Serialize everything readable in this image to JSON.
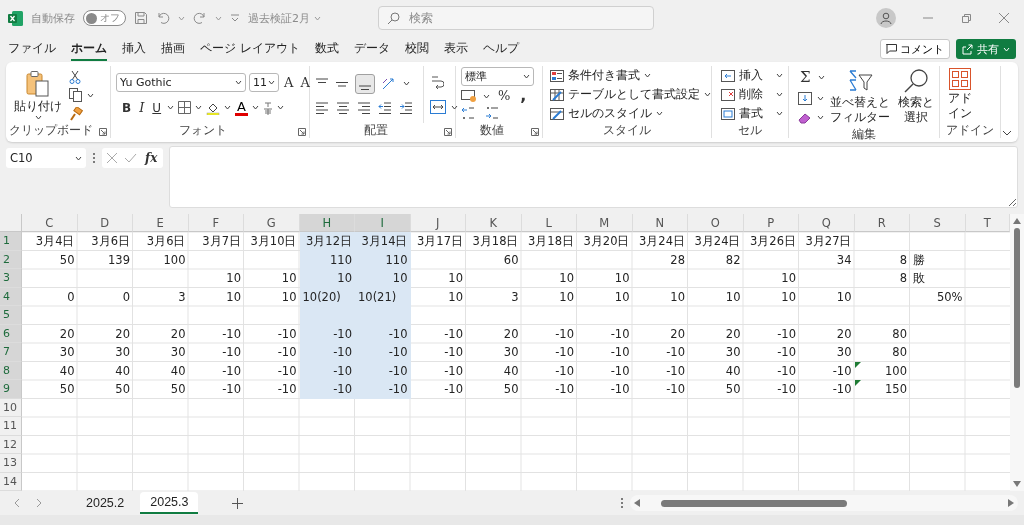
{
  "title_bar": {
    "autosave_label": "自動保存",
    "autosave_toggle": {
      "label": "オフ",
      "on": false
    },
    "document_title": "過去検証2月",
    "search": {
      "placeholder": "検索"
    }
  },
  "menu_tabs": [
    {
      "label": "ファイル",
      "selected": false
    },
    {
      "label": "ホーム",
      "selected": true
    },
    {
      "label": "挿入",
      "selected": false
    },
    {
      "label": "描画",
      "selected": false
    },
    {
      "label": "ページ レイアウト",
      "selected": false
    },
    {
      "label": "数式",
      "selected": false
    },
    {
      "label": "データ",
      "selected": false
    },
    {
      "label": "校閲",
      "selected": false
    },
    {
      "label": "表示",
      "selected": false
    },
    {
      "label": "ヘルプ",
      "selected": false
    }
  ],
  "menu_actions": {
    "comment": "コメント",
    "share": "共有"
  },
  "ribbon": {
    "groups": [
      {
        "kind": "clipboard",
        "label": "クリップボード",
        "paste": "貼り付け"
      },
      {
        "kind": "font",
        "label": "フォント",
        "font_name": "Yu Gothic",
        "font_size": "11",
        "grow_font": "A",
        "shrink_font": "A",
        "bold": "B",
        "italic": "I",
        "underline": "U",
        "font_color": "A"
      },
      {
        "kind": "alignment",
        "label": "配置"
      },
      {
        "kind": "number",
        "label": "数値",
        "format": "標準",
        "percent": "%",
        "comma": ","
      },
      {
        "kind": "styles",
        "label": "スタイル",
        "commands": [
          "条件付き書式",
          "テーブルとして書式設定",
          "セルのスタイル"
        ]
      },
      {
        "kind": "cells",
        "label": "セル",
        "commands": [
          "挿入",
          "削除",
          "書式"
        ]
      },
      {
        "kind": "editing",
        "label": "編集",
        "sum": "Σ",
        "sort_filter": [
          "並べ替えと",
          "フィルター"
        ],
        "find_select": [
          "検索と",
          "選択"
        ]
      },
      {
        "kind": "addins",
        "label": "アドイン",
        "button": [
          "アド",
          "イン"
        ]
      }
    ]
  },
  "formula_bar": {
    "name_box": "C10",
    "function_label": "fx"
  },
  "grid": {
    "columns": [
      {
        "label": "C",
        "selected": false
      },
      {
        "label": "D",
        "selected": false
      },
      {
        "label": "E",
        "selected": false
      },
      {
        "label": "F",
        "selected": false
      },
      {
        "label": "G",
        "selected": false
      },
      {
        "label": "H",
        "selected": true
      },
      {
        "label": "I",
        "selected": true
      },
      {
        "label": "J",
        "selected": false
      },
      {
        "label": "K",
        "selected": false
      },
      {
        "label": "L",
        "selected": false
      },
      {
        "label": "M",
        "selected": false
      },
      {
        "label": "N",
        "selected": false
      },
      {
        "label": "O",
        "selected": false
      },
      {
        "label": "P",
        "selected": false
      },
      {
        "label": "Q",
        "selected": false
      },
      {
        "label": "R",
        "selected": false
      },
      {
        "label": "S",
        "selected": false
      },
      {
        "label": "T",
        "selected": false
      }
    ],
    "rows": [
      {
        "number": "1",
        "selected": true,
        "cells": [
          {
            "text": "3月4日",
            "kind": "number"
          },
          {
            "text": "3月6日",
            "kind": "number"
          },
          {
            "text": "3月6日",
            "kind": "number"
          },
          {
            "text": "3月7日",
            "kind": "number"
          },
          {
            "text": "3月10日",
            "kind": "number"
          },
          {
            "text": "3月12日",
            "kind": "number"
          },
          {
            "text": "3月14日",
            "kind": "number"
          },
          {
            "text": "3月17日",
            "kind": "number"
          },
          {
            "text": "3月18日",
            "kind": "number"
          },
          {
            "text": "3月18日",
            "kind": "number"
          },
          {
            "text": "3月20日",
            "kind": "number"
          },
          {
            "text": "3月24日",
            "kind": "number"
          },
          {
            "text": "3月24日",
            "kind": "number"
          },
          {
            "text": "3月26日",
            "kind": "number"
          },
          {
            "text": "3月27日",
            "kind": "number"
          },
          null,
          null,
          null
        ]
      },
      {
        "number": "2",
        "selected": true,
        "cells": [
          {
            "text": "50",
            "kind": "number"
          },
          {
            "text": "139",
            "kind": "number"
          },
          {
            "text": "100",
            "kind": "number"
          },
          null,
          null,
          {
            "text": "110",
            "kind": "number"
          },
          {
            "text": "110",
            "kind": "number"
          },
          null,
          {
            "text": "60",
            "kind": "number"
          },
          null,
          null,
          {
            "text": "28",
            "kind": "number"
          },
          {
            "text": "82",
            "kind": "number"
          },
          null,
          {
            "text": "34",
            "kind": "number"
          },
          {
            "text": "8",
            "kind": "number"
          },
          {
            "text": "勝",
            "kind": "text"
          },
          null
        ]
      },
      {
        "number": "3",
        "selected": true,
        "cells": [
          null,
          null,
          null,
          {
            "text": "10",
            "kind": "number"
          },
          {
            "text": "10",
            "kind": "number"
          },
          {
            "text": "10",
            "kind": "number"
          },
          {
            "text": "10",
            "kind": "number"
          },
          {
            "text": "10",
            "kind": "number"
          },
          null,
          {
            "text": "10",
            "kind": "number"
          },
          {
            "text": "10",
            "kind": "number"
          },
          null,
          null,
          {
            "text": "10",
            "kind": "number"
          },
          null,
          {
            "text": "8",
            "kind": "number"
          },
          {
            "text": "敗",
            "kind": "text"
          },
          null
        ]
      },
      {
        "number": "4",
        "selected": true,
        "cells": [
          {
            "text": "0",
            "kind": "number"
          },
          {
            "text": "0",
            "kind": "number"
          },
          {
            "text": "3",
            "kind": "number"
          },
          {
            "text": "10",
            "kind": "number"
          },
          {
            "text": "10",
            "kind": "number"
          },
          {
            "text": "10(20)",
            "kind": "text"
          },
          {
            "text": "10(21)",
            "kind": "text"
          },
          {
            "text": "10",
            "kind": "number"
          },
          {
            "text": "3",
            "kind": "number"
          },
          {
            "text": "10",
            "kind": "number"
          },
          {
            "text": "10",
            "kind": "number"
          },
          {
            "text": "10",
            "kind": "number"
          },
          {
            "text": "10",
            "kind": "number"
          },
          {
            "text": "10",
            "kind": "number"
          },
          {
            "text": "10",
            "kind": "number"
          },
          null,
          {
            "text": "50%",
            "kind": "number"
          },
          null
        ]
      },
      {
        "number": "5",
        "selected": true
      },
      {
        "number": "6",
        "selected": true,
        "cells": [
          {
            "text": "20",
            "kind": "number"
          },
          {
            "text": "20",
            "kind": "number"
          },
          {
            "text": "20",
            "kind": "number"
          },
          {
            "text": "-10",
            "kind": "number"
          },
          {
            "text": "-10",
            "kind": "number"
          },
          {
            "text": "-10",
            "kind": "number"
          },
          {
            "text": "-10",
            "kind": "number"
          },
          {
            "text": "-10",
            "kind": "number"
          },
          {
            "text": "20",
            "kind": "number"
          },
          {
            "text": "-10",
            "kind": "number"
          },
          {
            "text": "-10",
            "kind": "number"
          },
          {
            "text": "20",
            "kind": "number"
          },
          {
            "text": "20",
            "kind": "number"
          },
          {
            "text": "-10",
            "kind": "number"
          },
          {
            "text": "20",
            "kind": "number"
          },
          {
            "text": "80",
            "kind": "number"
          },
          null,
          null
        ]
      },
      {
        "number": "7",
        "selected": true,
        "cells": [
          {
            "text": "30",
            "kind": "number"
          },
          {
            "text": "30",
            "kind": "number"
          },
          {
            "text": "30",
            "kind": "number"
          },
          {
            "text": "-10",
            "kind": "number"
          },
          {
            "text": "-10",
            "kind": "number"
          },
          {
            "text": "-10",
            "kind": "number"
          },
          {
            "text": "-10",
            "kind": "number"
          },
          {
            "text": "-10",
            "kind": "number"
          },
          {
            "text": "30",
            "kind": "number"
          },
          {
            "text": "-10",
            "kind": "number"
          },
          {
            "text": "-10",
            "kind": "number"
          },
          {
            "text": "-10",
            "kind": "number"
          },
          {
            "text": "30",
            "kind": "number"
          },
          {
            "text": "-10",
            "kind": "number"
          },
          {
            "text": "30",
            "kind": "number"
          },
          {
            "text": "80",
            "kind": "number"
          },
          null,
          null
        ]
      },
      {
        "number": "8",
        "selected": true,
        "cells": [
          {
            "text": "40",
            "kind": "number"
          },
          {
            "text": "40",
            "kind": "number"
          },
          {
            "text": "40",
            "kind": "number"
          },
          {
            "text": "-10",
            "kind": "number"
          },
          {
            "text": "-10",
            "kind": "number"
          },
          {
            "text": "-10",
            "kind": "number"
          },
          {
            "text": "-10",
            "kind": "number"
          },
          {
            "text": "-10",
            "kind": "number"
          },
          {
            "text": "40",
            "kind": "number"
          },
          {
            "text": "-10",
            "kind": "number"
          },
          {
            "text": "-10",
            "kind": "number"
          },
          {
            "text": "-10",
            "kind": "number"
          },
          {
            "text": "40",
            "kind": "number"
          },
          {
            "text": "-10",
            "kind": "number"
          },
          {
            "text": "-10",
            "kind": "number"
          },
          {
            "text": "100",
            "kind": "flagged"
          },
          null,
          null
        ]
      },
      {
        "number": "9",
        "selected": true,
        "cells": [
          {
            "text": "50",
            "kind": "number"
          },
          {
            "text": "50",
            "kind": "number"
          },
          {
            "text": "50",
            "kind": "number"
          },
          {
            "text": "-10",
            "kind": "number"
          },
          {
            "text": "-10",
            "kind": "number"
          },
          {
            "text": "-10",
            "kind": "number"
          },
          {
            "text": "-10",
            "kind": "number"
          },
          {
            "text": "-10",
            "kind": "number"
          },
          {
            "text": "50",
            "kind": "number"
          },
          {
            "text": "-10",
            "kind": "number"
          },
          {
            "text": "-10",
            "kind": "number"
          },
          {
            "text": "-10",
            "kind": "number"
          },
          {
            "text": "50",
            "kind": "number"
          },
          {
            "text": "-10",
            "kind": "number"
          },
          {
            "text": "-10",
            "kind": "number"
          },
          {
            "text": "150",
            "kind": "flagged"
          },
          null,
          null
        ]
      },
      {
        "number": "10",
        "selected": false
      },
      {
        "number": "11",
        "selected": false
      },
      {
        "number": "12",
        "selected": false
      },
      {
        "number": "13",
        "selected": false
      },
      {
        "number": "14",
        "selected": false
      }
    ]
  },
  "sheet_tabs": [
    {
      "label": "2025.2",
      "selected": false
    },
    {
      "label": "2025.3",
      "selected": true
    }
  ]
}
